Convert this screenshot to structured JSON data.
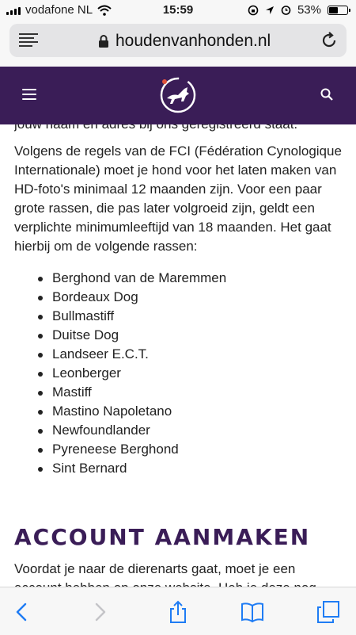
{
  "status_bar": {
    "carrier": "vodafone NL",
    "time": "15:59",
    "battery": "53%",
    "battery_level": 0.53
  },
  "browser": {
    "url": "houdenvanhonden.nl"
  },
  "content": {
    "cutoff_text": "jouw naam en adres bij ons geregistreerd staat.",
    "paragraph1": "Volgens de regels van de FCI (Fédération Cynologique Internationale) moet je hond voor het laten maken van HD-foto's minimaal 12 maanden zijn. Voor een paar grote rassen, die pas later volgroeid zijn, geldt een verplichte minimumleeftijd van 18 maanden. Het gaat hierbij om de volgende rassen:",
    "breeds": [
      "Berghond van de Maremmen",
      "Bordeaux Dog",
      "Bullmastiff",
      "Duitse Dog",
      "Landseer E.C.T.",
      "Leonberger",
      "Mastiff",
      "Mastino Napoletano",
      "Newfoundlander",
      "Pyreneese Berghond",
      "Sint Bernard"
    ],
    "section_title": "ACCOUNT AANMAKEN",
    "paragraph2": "Voordat je naar de dierenarts gaat, moet je een account hebben op onze website. Heb je deze nog niet, dan kan"
  },
  "colors": {
    "header_bg": "#3a1d57",
    "accent": "#3a1d57",
    "ios_blue": "#1f7cf4"
  },
  "icons": {
    "back": "chevron-left-icon",
    "forward": "chevron-right-icon",
    "share": "share-icon",
    "bookmarks": "book-icon",
    "tabs": "tabs-icon"
  }
}
